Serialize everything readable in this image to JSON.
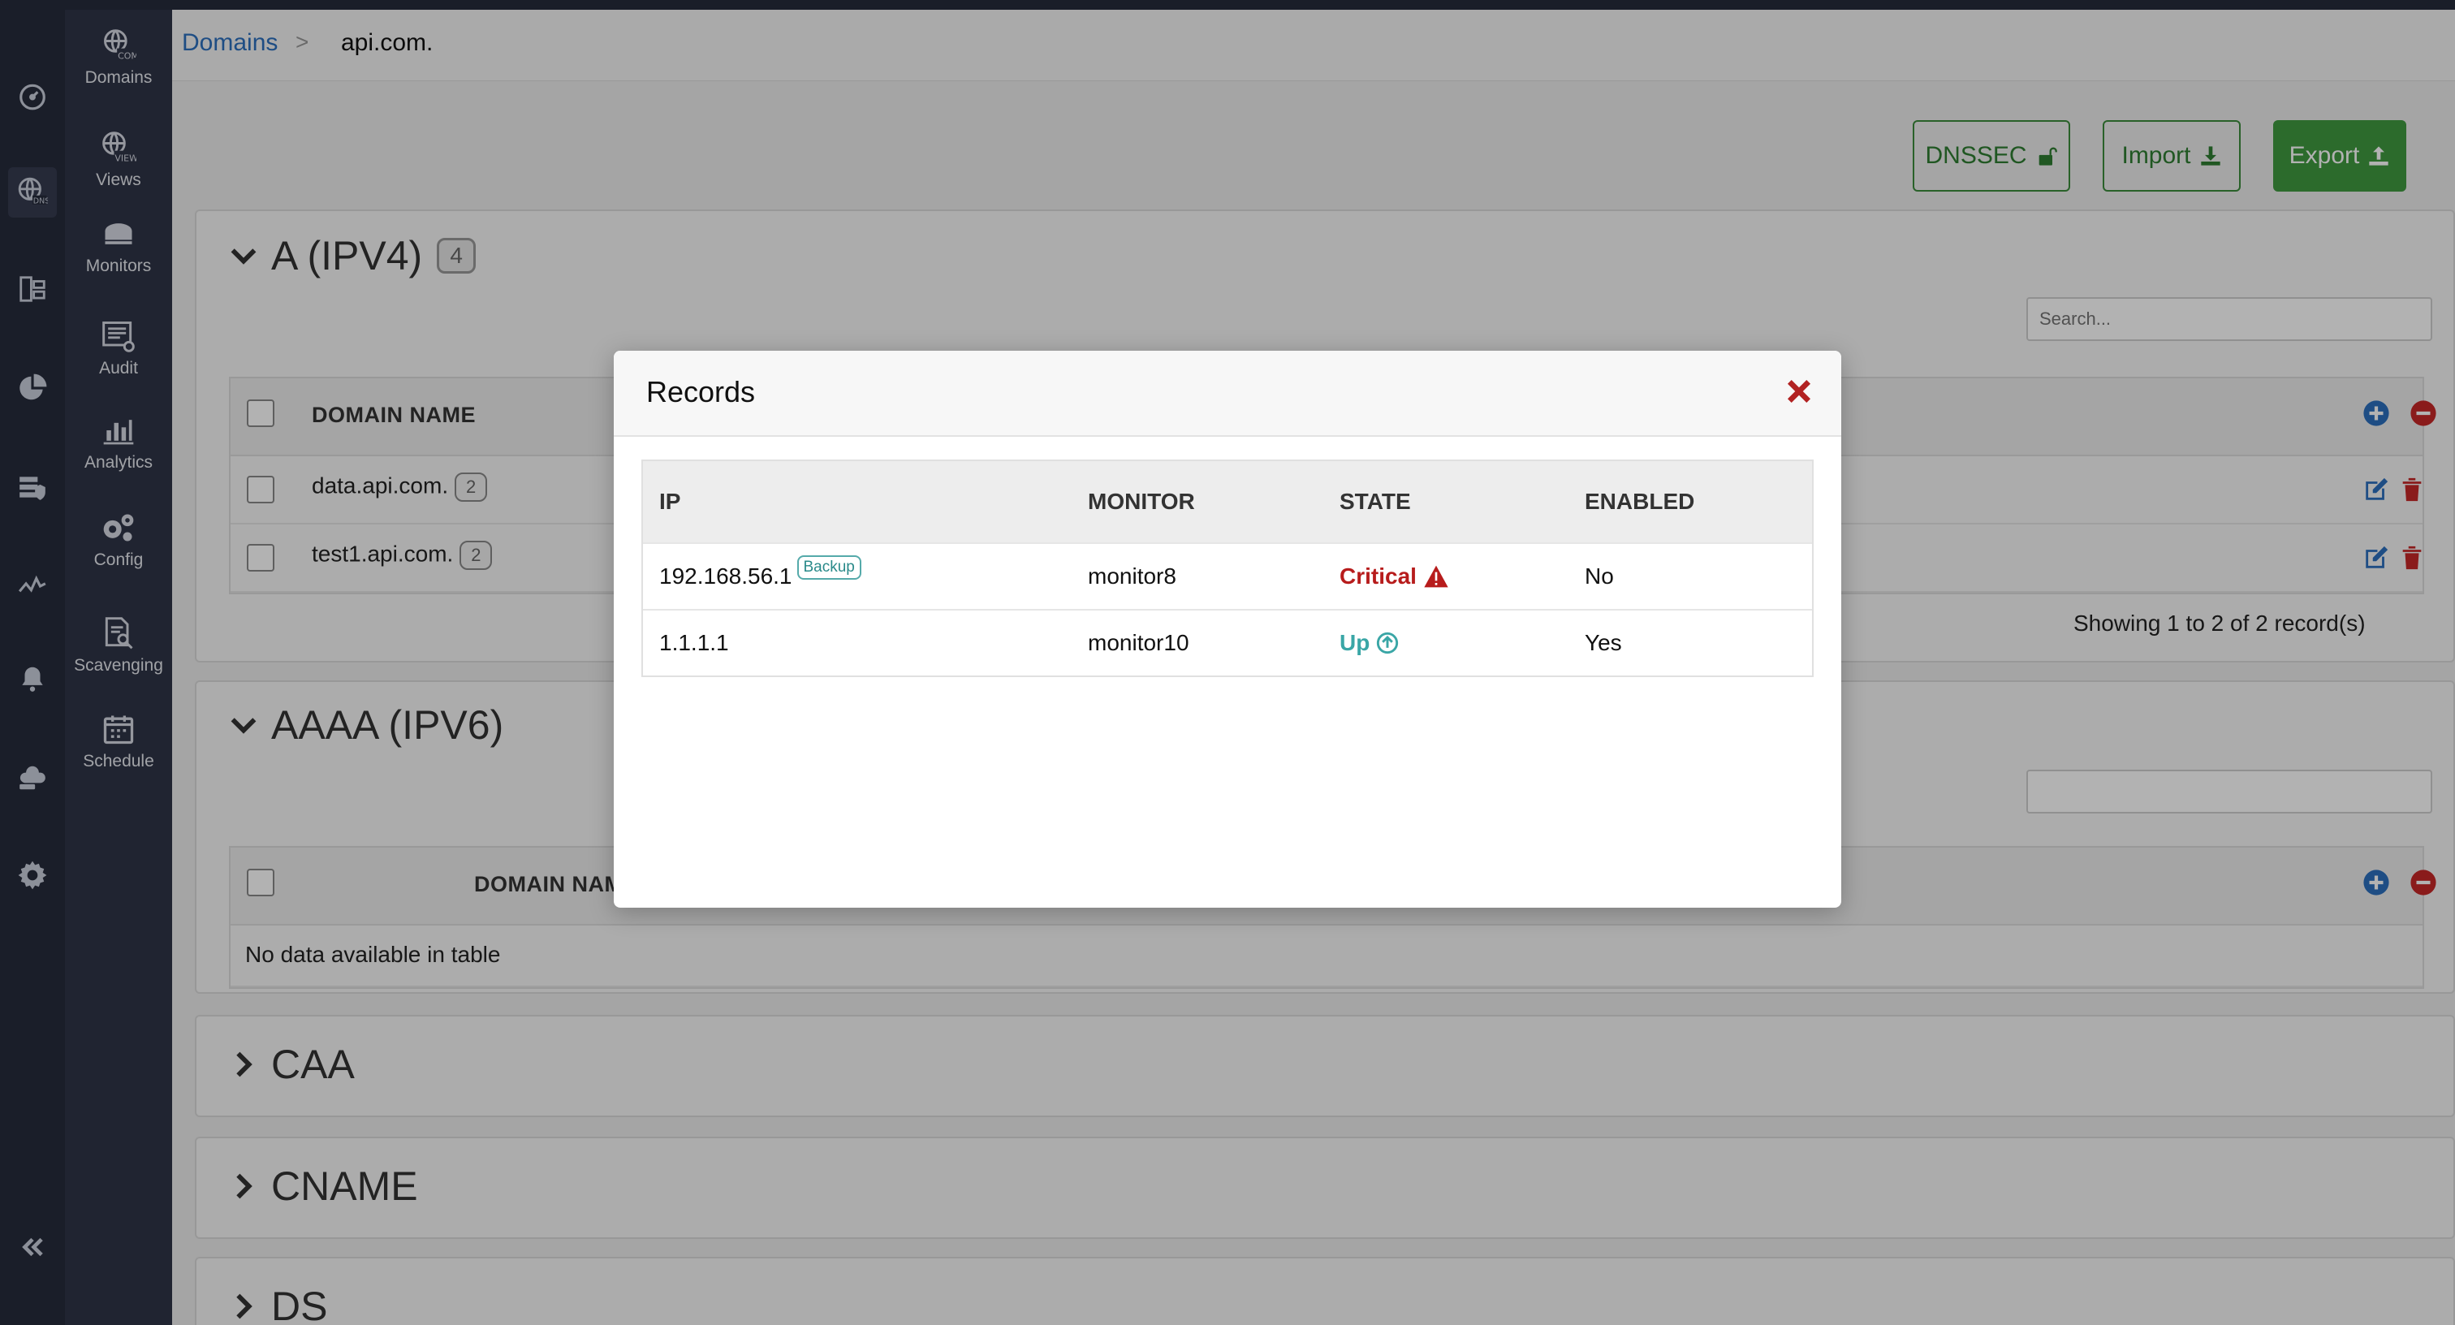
{
  "nav": {
    "items": [
      {
        "label": "Domains"
      },
      {
        "label": "Views"
      },
      {
        "label": "Monitors"
      },
      {
        "label": "Audit"
      },
      {
        "label": "Analytics"
      },
      {
        "label": "Config"
      },
      {
        "label": "Scavenging"
      },
      {
        "label": "Schedule"
      }
    ]
  },
  "breadcrumb": {
    "parent": "Domains",
    "separator": ">",
    "current": "api.com."
  },
  "toolbar": {
    "dnssec": "DNSSEC",
    "import": "Import",
    "export": "Export"
  },
  "sections": {
    "a": {
      "title": "A (IPV4)",
      "count": "4",
      "search_placeholder": "Search...",
      "column_domain": "DOMAIN NAME",
      "rows": [
        {
          "name": "data.api.com.",
          "count": "2"
        },
        {
          "name": "test1.api.com.",
          "count": "2"
        }
      ],
      "showing": "Showing 1 to 2 of 2 record(s)"
    },
    "aaaa": {
      "title": "AAAA (IPV6)",
      "column_domain": "DOMAIN NAME",
      "empty": "No data available in table"
    },
    "caa": {
      "title": "CAA"
    },
    "cname": {
      "title": "CNAME"
    },
    "ds": {
      "title": "DS"
    }
  },
  "modal": {
    "title": "Records",
    "columns": {
      "ip": "IP",
      "monitor": "MONITOR",
      "state": "STATE",
      "enabled": "ENABLED"
    },
    "rows": [
      {
        "ip": "192.168.56.1",
        "tag": "Backup",
        "monitor": "monitor8",
        "state": "Critical",
        "enabled": "No"
      },
      {
        "ip": "1.1.1.1",
        "monitor": "monitor10",
        "state": "Up",
        "enabled": "Yes"
      }
    ]
  },
  "colors": {
    "primary_link": "#2c6fbe",
    "success": "#3f9a3f",
    "danger": "#b71c1c",
    "up": "#3aa6a6",
    "sidebar": "#262b3b"
  }
}
